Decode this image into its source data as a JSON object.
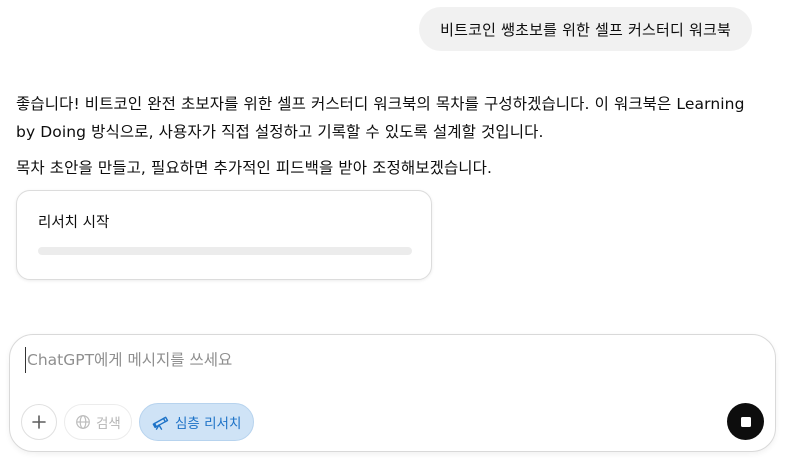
{
  "conversation": {
    "user_message": "비트코인 쌩초보를 위한 셀프 커스터디 워크북",
    "assistant_paragraph_1": "좋습니다! 비트코인 완전 초보자를 위한 셀프 커스터디 워크북의 목차를 구성하겠습니다. 이 워크북은 Learning by Doing 방식으로, 사용자가 직접 설정하고 기록할 수 있도록 설계할 것입니다.",
    "assistant_paragraph_2": "목차 초안을 만들고, 필요하면 추가적인 피드백을 받아 조정해보겠습니다.",
    "research_card": {
      "title": "리서치 시작",
      "progress": 0
    }
  },
  "composer": {
    "placeholder": "ChatGPT에게 메시지를 쓰세요",
    "value": "",
    "search_label": "검색",
    "deep_research_label": "심층 리서치",
    "icons": {
      "add": "plus-icon",
      "search": "globe-icon",
      "deep_research": "telescope-icon",
      "stop": "stop-icon"
    }
  },
  "colors": {
    "user_bubble_bg": "#f1f1f1",
    "deep_research_bg": "#cfe3f6",
    "deep_research_text": "#1c72c7",
    "stop_button": "#0d0d0d"
  }
}
